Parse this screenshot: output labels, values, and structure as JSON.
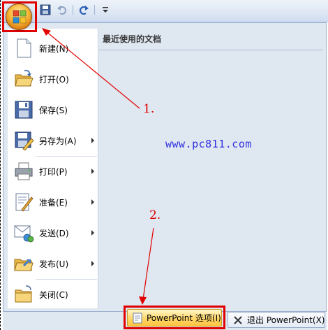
{
  "quick_access": {
    "icons": [
      "save-icon",
      "undo-icon",
      "redo-icon",
      "customize-dropdown-icon"
    ]
  },
  "menu": {
    "items": [
      {
        "label": "新建(N)",
        "icon": "new-document-icon",
        "submenu": false
      },
      {
        "label": "打开(O)",
        "icon": "open-folder-icon",
        "submenu": false
      },
      {
        "label": "保存(S)",
        "icon": "save-icon",
        "submenu": false
      },
      {
        "label": "另存为(A)",
        "icon": "save-as-icon",
        "submenu": true
      },
      {
        "label": "打印(P)",
        "icon": "printer-icon",
        "submenu": true
      },
      {
        "label": "准备(E)",
        "icon": "prepare-icon",
        "submenu": true
      },
      {
        "label": "发送(D)",
        "icon": "send-icon",
        "submenu": true
      },
      {
        "label": "发布(U)",
        "icon": "publish-icon",
        "submenu": true
      },
      {
        "label": "关闭(C)",
        "icon": "close-folder-icon",
        "submenu": false
      }
    ],
    "recent_header": "最近使用的文档"
  },
  "bottom": {
    "options_label": "PowerPoint 选项(I)",
    "exit_label": "退出 PowerPoint(X)"
  },
  "annotations": {
    "step1": "1.",
    "step2": "2.",
    "watermark": "www.pc811.com"
  },
  "colors": {
    "annotation_red": "#e00000",
    "watermark_blue": "#3030e0",
    "menu_background": "#dfe7f1"
  }
}
